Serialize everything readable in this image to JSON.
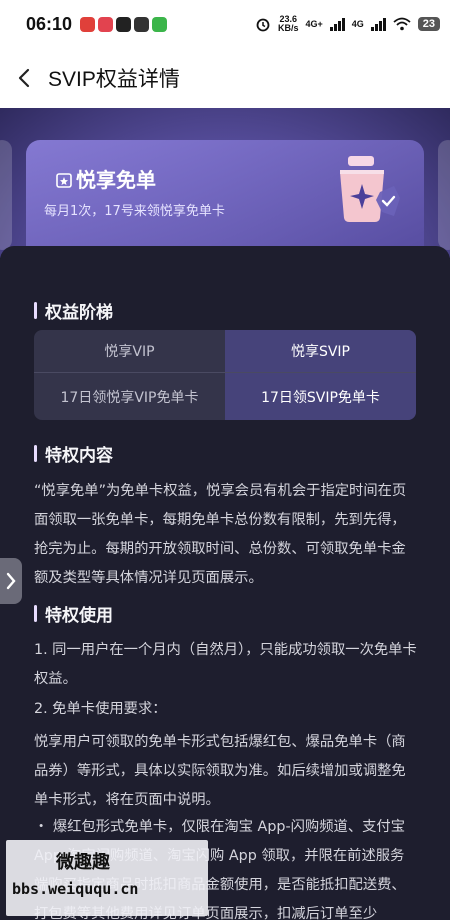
{
  "status_bar": {
    "time": "06:10",
    "net_speed_value": "23.6",
    "net_speed_unit": "KB/s",
    "network_1": "4G+",
    "network_2": "4G",
    "battery": "23"
  },
  "header": {
    "title": "SVIP权益详情",
    "back_icon": "chevron-left-icon"
  },
  "banner": {
    "card_title": "悦享免单",
    "card_subtitle": "每月1次，17号来领悦享免单卡",
    "card_icon": "cup-star-icon"
  },
  "sections": {
    "ladder_title": "权益阶梯",
    "content_title": "特权内容",
    "usage_title": "特权使用"
  },
  "tier_table": {
    "headers": [
      "悦享VIP",
      "悦享SVIP"
    ],
    "rows": [
      [
        "17日领悦享VIP免单卡",
        "17日领SVIP免单卡"
      ]
    ],
    "highlight_column": 1
  },
  "content_text": "“悦享免单”为免单卡权益，悦享会员有机会于指定时间在页面领取一张免单卡，每期免单卡总份数有限制，先到先得，抢完为止。每期的开放领取时间、总份数、可领取免单卡金额及类型等具体情况详见页面展示。",
  "usage": {
    "item1": "1. 同一用户在一个月内（自然月），只能成功领取一次免单卡权益。",
    "item2": "2. 免单卡使用要求：",
    "item2_desc": "悦享用户可领取的免单卡形式包括爆红包、爆品免单卡（商品券）等形式，具体以实际领取为准。如后续增加或调整免单卡形式，将在页面中说明。",
    "bullet1": "・ 爆红包形式免单卡，仅限在淘宝 App-闪购频道、支付宝 App-淘宝闪购频道、淘宝闪购 App 领取，并限在前述服务端购买指定商品时抵扣商品金额使用，是否能抵扣配送费、打包费等其他费用详见订单页面展示，扣减后订单至少"
  },
  "side_handle_icon": "chevron-right-icon",
  "watermark": {
    "line1": "微趣趣",
    "line2": "bbs.weiququ.cn"
  }
}
